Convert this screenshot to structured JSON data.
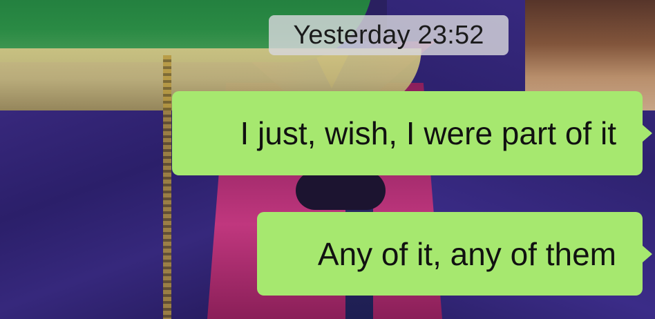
{
  "chat": {
    "timestamp": "Yesterday 23:52",
    "messages": [
      {
        "text": "I just, wish, I were part of it",
        "direction": "outgoing"
      },
      {
        "text": "Any of it, any of them",
        "direction": "outgoing"
      }
    ]
  },
  "colors": {
    "outgoing_bubble": "#a6e86f",
    "timestamp_pill": "#d7d7dc"
  }
}
